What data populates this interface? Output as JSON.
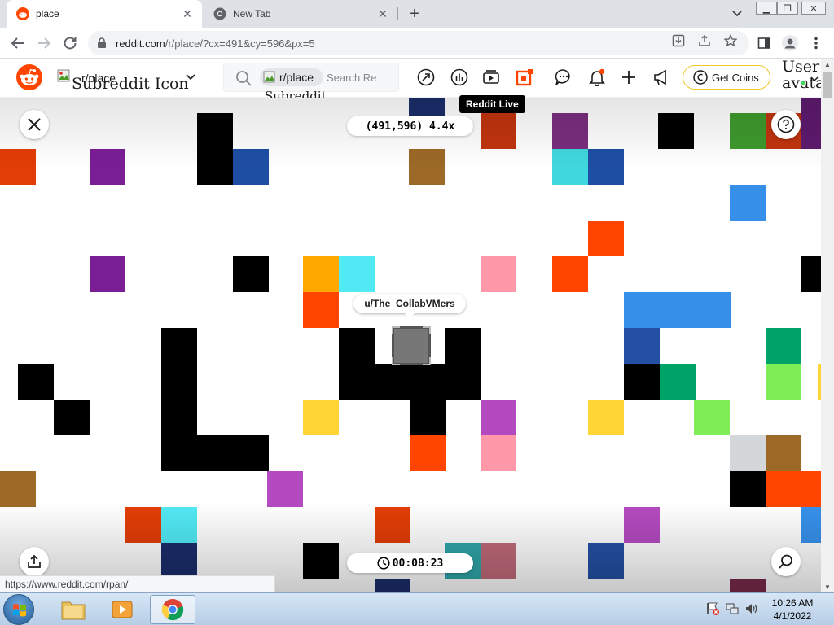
{
  "browser": {
    "tabs": [
      {
        "title": "place",
        "active": true
      },
      {
        "title": "New Tab",
        "active": false
      }
    ],
    "url_host": "reddit.com",
    "url_path": "/r/place/?cx=491&cy=596&px=5",
    "status_url": "https://www.reddit.com/rpan/"
  },
  "reddit": {
    "community": "r/place",
    "community_img_alt": "Subreddit Icon",
    "search_chip": "r/place",
    "search_chip_alt": "Subreddit Icon",
    "search_placeholder": "Search Reddit",
    "tooltip": "Reddit Live",
    "get_coins": "Get Coins",
    "user_alt": "User avatar",
    "colors": {
      "brand": "#ff4500",
      "coins_border": "#edc72b",
      "online": "#46d160"
    }
  },
  "place": {
    "coordinates": "(491,596) 4.4x",
    "timer": "00:08:23",
    "selected_user": "u/The_CollabVMers",
    "pixels": [
      [
        "#1b2d6b",
        502,
        0
      ],
      [
        "#c1340e",
        590,
        19
      ],
      [
        "#7b2e7e",
        678,
        19
      ],
      [
        "#000000",
        242,
        19
      ],
      [
        "#000000",
        808,
        19
      ],
      [
        "#3e9a2e",
        896,
        19
      ],
      [
        "#c1340e",
        940,
        19
      ],
      [
        "#5e1a6e",
        984,
        0
      ],
      [
        "#5e1a6e",
        984,
        19
      ],
      [
        "#7a1e96",
        110,
        63
      ],
      [
        "#000000",
        242,
        63
      ],
      [
        "#1e4ea4",
        286,
        63
      ],
      [
        "#9c6926",
        502,
        63
      ],
      [
        "#40d8de",
        678,
        63
      ],
      [
        "#1e4ea4",
        722,
        63
      ],
      [
        "#e23d06",
        0,
        63
      ],
      [
        "#3690ea",
        896,
        107
      ],
      [
        "#ff4500",
        722,
        151
      ],
      [
        "#7a1e96",
        110,
        195
      ],
      [
        "#000000",
        286,
        195
      ],
      [
        "#ffa800",
        372,
        195
      ],
      [
        "#51e9f4",
        416,
        195
      ],
      [
        "#ff99aa",
        590,
        195
      ],
      [
        "#ff4500",
        678,
        195
      ],
      [
        "#000000",
        984,
        195
      ],
      [
        "#ff4500",
        372,
        239
      ],
      [
        "#3690ea",
        766,
        239
      ],
      [
        "#3690ea",
        810,
        239
      ],
      [
        "#3690ea",
        854,
        239
      ],
      [
        "#000000",
        198,
        283
      ],
      [
        "#000000",
        416,
        283
      ],
      [
        "#000000",
        546,
        283
      ],
      [
        "#2450a4",
        766,
        283
      ],
      [
        "#00a368",
        940,
        283
      ],
      [
        "#000000",
        22,
        327
      ],
      [
        "#000000",
        198,
        327
      ],
      [
        "#000000",
        416,
        327
      ],
      [
        "#000000",
        460,
        327
      ],
      [
        "#000000",
        504,
        327
      ],
      [
        "#000000",
        546,
        327
      ],
      [
        "#000000",
        766,
        327
      ],
      [
        "#00a368",
        810,
        327
      ],
      [
        "#7eed56",
        940,
        327
      ],
      [
        "#ffd635",
        1004,
        327
      ],
      [
        "#000000",
        66,
        371
      ],
      [
        "#000000",
        198,
        371
      ],
      [
        "#ffd635",
        372,
        371
      ],
      [
        "#000000",
        504,
        371
      ],
      [
        "#b44ac0",
        590,
        371
      ],
      [
        "#ffd635",
        722,
        371
      ],
      [
        "#7eed56",
        852,
        371
      ],
      [
        "#000000",
        198,
        415
      ],
      [
        "#000000",
        242,
        415
      ],
      [
        "#000000",
        286,
        415
      ],
      [
        "#ff4500",
        504,
        415
      ],
      [
        "#ff99aa",
        590,
        415
      ],
      [
        "#d4d7d9",
        896,
        415
      ],
      [
        "#9c6926",
        940,
        415
      ],
      [
        "#b44ac0",
        328,
        459
      ],
      [
        "#000000",
        896,
        459
      ],
      [
        "#ff4500",
        940,
        459
      ],
      [
        "#ff4500",
        984,
        459
      ],
      [
        "#9c6926",
        0,
        459
      ],
      [
        "#e23d06",
        154,
        503
      ],
      [
        "#51e9f4",
        198,
        503
      ],
      [
        "#e23d06",
        460,
        503
      ],
      [
        "#b44ac0",
        766,
        503
      ],
      [
        "#3690ea",
        984,
        503
      ],
      [
        "#1b2d6b",
        198,
        547
      ],
      [
        "#000000",
        372,
        547
      ],
      [
        "#2fa6a8",
        546,
        547
      ],
      [
        "#c06a7a",
        590,
        547
      ],
      [
        "#2450a4",
        722,
        547
      ],
      [
        "#1b2d6b",
        460,
        591
      ],
      [
        "#7a2a4a",
        896,
        591
      ]
    ]
  },
  "taskbar": {
    "time": "10:26 AM",
    "date": "4/1/2022"
  }
}
